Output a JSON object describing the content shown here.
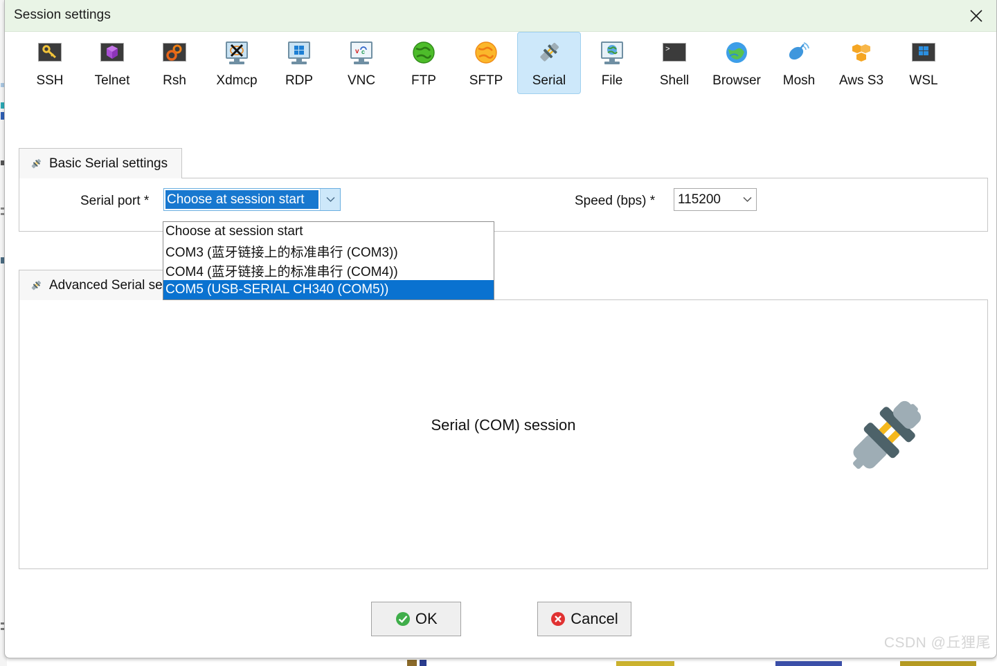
{
  "window": {
    "title": "Session settings",
    "close_icon": "close-icon"
  },
  "session_types": [
    {
      "label": "SSH",
      "icon": "ssh-key-icon",
      "selected": false
    },
    {
      "label": "Telnet",
      "icon": "telnet-cube-icon",
      "selected": false
    },
    {
      "label": "Rsh",
      "icon": "rsh-gears-icon",
      "selected": false
    },
    {
      "label": "Xdmcp",
      "icon": "xdmcp-monitor-icon",
      "selected": false
    },
    {
      "label": "RDP",
      "icon": "rdp-monitor-icon",
      "selected": false
    },
    {
      "label": "VNC",
      "icon": "vnc-monitor-icon",
      "selected": false
    },
    {
      "label": "FTP",
      "icon": "ftp-globe-icon",
      "selected": false
    },
    {
      "label": "SFTP",
      "icon": "sftp-globe-icon",
      "selected": false
    },
    {
      "label": "Serial",
      "icon": "serial-plug-icon",
      "selected": true
    },
    {
      "label": "File",
      "icon": "file-monitor-icon",
      "selected": false
    },
    {
      "label": "Shell",
      "icon": "shell-terminal-icon",
      "selected": false
    },
    {
      "label": "Browser",
      "icon": "browser-globe-icon",
      "selected": false
    },
    {
      "label": "Mosh",
      "icon": "mosh-dish-icon",
      "selected": false
    },
    {
      "label": "Aws S3",
      "icon": "aws-s3-cubes-icon",
      "selected": false
    },
    {
      "label": "WSL",
      "icon": "wsl-windows-icon",
      "selected": false
    }
  ],
  "basic_tab": {
    "title": "Basic Serial settings",
    "icon": "plug-icon",
    "serial_port": {
      "label": "Serial port *",
      "value": "Choose at session start",
      "arrow_icon": "chevron-down-icon",
      "dropdown_open": true,
      "options": [
        {
          "label": "Choose at session start",
          "selected": false
        },
        {
          "label": "COM3  (蓝牙链接上的标准串行 (COM3))",
          "selected": false
        },
        {
          "label": "COM4  (蓝牙链接上的标准串行 (COM4))",
          "selected": false
        },
        {
          "label": "COM5  (USB-SERIAL CH340 (COM5))",
          "selected": true
        }
      ]
    },
    "speed": {
      "label": "Speed (bps) *",
      "value": "115200",
      "arrow_icon": "chevron-down-icon"
    }
  },
  "advanced_tab": {
    "title": "Advanced Serial settings",
    "icon": "plug-icon",
    "caption": "Serial (COM) session",
    "illustration_icon": "serial-plug-illustration"
  },
  "footer": {
    "ok_label": "OK",
    "ok_icon": "check-circle-icon",
    "cancel_label": "Cancel",
    "cancel_icon": "x-circle-icon"
  },
  "watermark": "CSDN @丘狸尾",
  "colors": {
    "title_bar": "#e9f4e6",
    "selection_blue": "#1878cf",
    "dropdown_selected": "#0a72d0",
    "selected_tile": "#cde8fa",
    "ok_green": "#3fae4a",
    "cancel_red": "#e03232"
  }
}
